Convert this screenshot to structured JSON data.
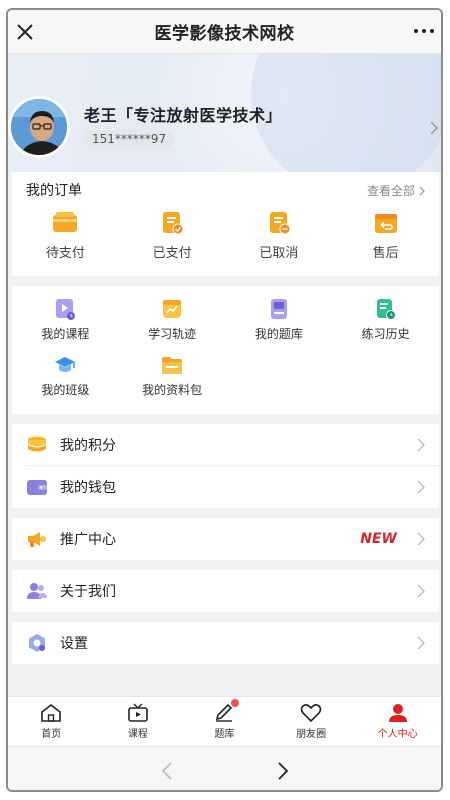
{
  "window": {
    "title": "医学影像技术网校"
  },
  "profile": {
    "name": "老王「专注放射医学技术」",
    "phone": "151******97"
  },
  "orders": {
    "title": "我的订单",
    "view_all": "查看全部",
    "items": [
      {
        "label": "待支付",
        "icon": "wallet-icon"
      },
      {
        "label": "已支付",
        "icon": "paid-receipt-icon"
      },
      {
        "label": "已取消",
        "icon": "cancelled-receipt-icon"
      },
      {
        "label": "售后",
        "icon": "return-box-icon"
      }
    ]
  },
  "tools": {
    "items": [
      {
        "label": "我的课程",
        "icon": "course-icon"
      },
      {
        "label": "学习轨迹",
        "icon": "trend-icon"
      },
      {
        "label": "我的题库",
        "icon": "question-bank-icon"
      },
      {
        "label": "练习历史",
        "icon": "history-icon"
      },
      {
        "label": "我的班级",
        "icon": "graduation-cap-icon"
      },
      {
        "label": "我的资料包",
        "icon": "folder-icon"
      }
    ]
  },
  "menu": {
    "points": "我的积分",
    "wallet": "我的钱包",
    "promo": "推广中心",
    "promo_badge": "NEW",
    "about": "关于我们",
    "settings": "设置"
  },
  "tabbar": {
    "items": [
      {
        "label": "首页",
        "icon": "home-icon"
      },
      {
        "label": "课程",
        "icon": "tv-icon"
      },
      {
        "label": "题库",
        "icon": "pencil-icon"
      },
      {
        "label": "朋友圈",
        "icon": "heart-icon"
      },
      {
        "label": "个人中心",
        "icon": "person-icon"
      }
    ]
  },
  "colors": {
    "accent": "#e02020",
    "orange": "#f5a623",
    "purple": "#8b7fe0",
    "green": "#2ec28e"
  }
}
